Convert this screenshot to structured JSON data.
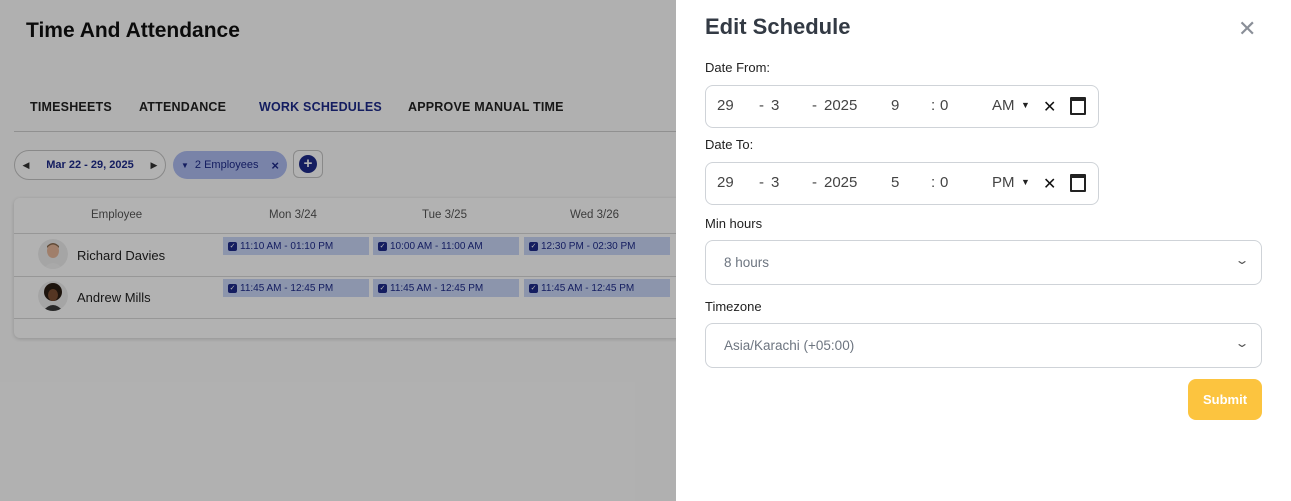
{
  "page": {
    "title": "Time And Attendance",
    "tabs": [
      {
        "label": "TIMESHEETS"
      },
      {
        "label": "ATTENDANCE"
      },
      {
        "label": "WORK SCHEDULES"
      },
      {
        "label": "APPROVE MANUAL TIME"
      }
    ],
    "active_tab": "WORK SCHEDULES",
    "date_range": "Mar 22  -  29, 2025",
    "employee_filter": "2 Employees"
  },
  "grid": {
    "columns": [
      "Employee",
      "Mon 3/24",
      "Tue 3/25",
      "Wed 3/26"
    ],
    "rows": [
      {
        "name": "Richard Davies",
        "shifts": [
          "11:10 AM - 01:10 PM",
          "10:00 AM - 11:00 AM",
          "12:30 PM - 02:30 PM"
        ]
      },
      {
        "name": "Andrew Mills",
        "shifts": [
          "11:45 AM - 12:45 PM",
          "11:45 AM - 12:45 PM",
          "11:45 AM - 12:45 PM"
        ]
      }
    ]
  },
  "drawer": {
    "title": "Edit Schedule",
    "date_from": {
      "label": "Date From:",
      "day": "29",
      "month": "3",
      "year": "2025",
      "hour": "9",
      "minute": "0",
      "ampm": "AM"
    },
    "date_to": {
      "label": "Date To:",
      "day": "29",
      "month": "3",
      "year": "2025",
      "hour": "5",
      "minute": "0",
      "ampm": "PM"
    },
    "min_hours": {
      "label": "Min hours",
      "value": "8 hours"
    },
    "timezone": {
      "label": "Timezone",
      "value": "Asia/Karachi (+05:00)"
    },
    "submit_label": "Submit"
  },
  "colors": {
    "accent": "#1d2a8a",
    "submit": "#fcc43f",
    "chip": "#aebcf1"
  }
}
